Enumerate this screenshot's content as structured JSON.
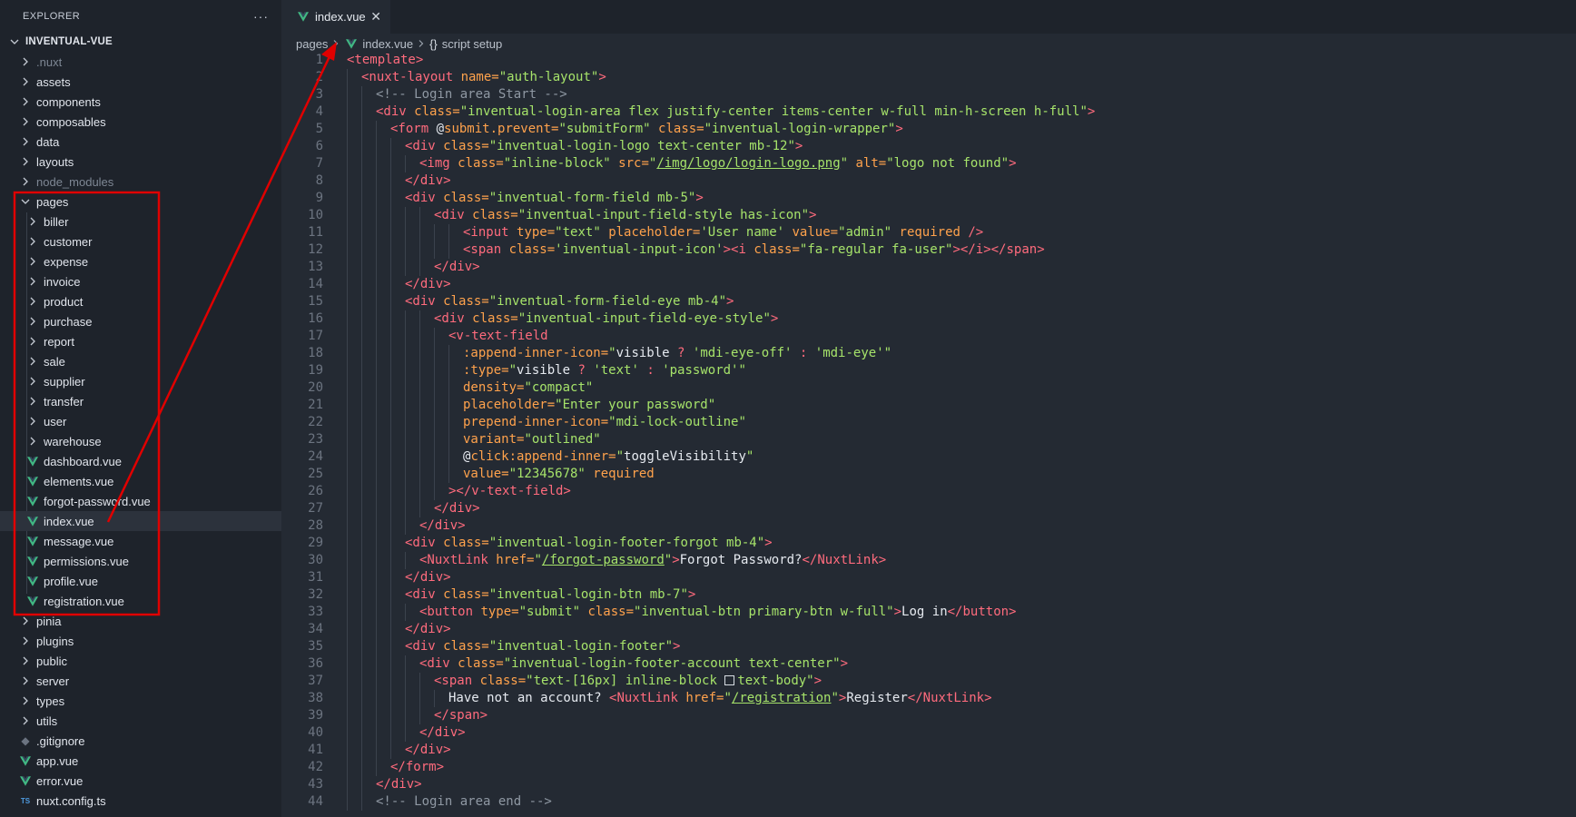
{
  "explorer": {
    "title": "EXPLORER",
    "more": "···",
    "tree": [
      {
        "label": "INVENTUAL-VUE",
        "kind": "root"
      },
      {
        "label": ".nuxt",
        "kind": "folder",
        "dim": true
      },
      {
        "label": "assets",
        "kind": "folder"
      },
      {
        "label": "components",
        "kind": "folder"
      },
      {
        "label": "composables",
        "kind": "folder"
      },
      {
        "label": "data",
        "kind": "folder"
      },
      {
        "label": "layouts",
        "kind": "folder"
      },
      {
        "label": "node_modules",
        "kind": "folder",
        "dim": true
      },
      {
        "label": "pages",
        "kind": "folder-open"
      },
      {
        "label": "biller",
        "kind": "folder",
        "depth": 1
      },
      {
        "label": "customer",
        "kind": "folder",
        "depth": 1
      },
      {
        "label": "expense",
        "kind": "folder",
        "depth": 1
      },
      {
        "label": "invoice",
        "kind": "folder",
        "depth": 1
      },
      {
        "label": "product",
        "kind": "folder",
        "depth": 1
      },
      {
        "label": "purchase",
        "kind": "folder",
        "depth": 1
      },
      {
        "label": "report",
        "kind": "folder",
        "depth": 1
      },
      {
        "label": "sale",
        "kind": "folder",
        "depth": 1
      },
      {
        "label": "supplier",
        "kind": "folder",
        "depth": 1
      },
      {
        "label": "transfer",
        "kind": "folder",
        "depth": 1
      },
      {
        "label": "user",
        "kind": "folder",
        "depth": 1
      },
      {
        "label": "warehouse",
        "kind": "folder",
        "depth": 1
      },
      {
        "label": "dashboard.vue",
        "kind": "vue",
        "depth": 1
      },
      {
        "label": "elements.vue",
        "kind": "vue",
        "depth": 1
      },
      {
        "label": "forgot-password.vue",
        "kind": "vue",
        "depth": 1
      },
      {
        "label": "index.vue",
        "kind": "vue",
        "depth": 1,
        "active": true
      },
      {
        "label": "message.vue",
        "kind": "vue",
        "depth": 1
      },
      {
        "label": "permissions.vue",
        "kind": "vue",
        "depth": 1
      },
      {
        "label": "profile.vue",
        "kind": "vue",
        "depth": 1
      },
      {
        "label": "registration.vue",
        "kind": "vue",
        "depth": 1
      },
      {
        "label": "pinia",
        "kind": "folder"
      },
      {
        "label": "plugins",
        "kind": "folder"
      },
      {
        "label": "public",
        "kind": "folder"
      },
      {
        "label": "server",
        "kind": "folder"
      },
      {
        "label": "types",
        "kind": "folder"
      },
      {
        "label": "utils",
        "kind": "folder"
      },
      {
        "label": ".gitignore",
        "kind": "git"
      },
      {
        "label": "app.vue",
        "kind": "vue"
      },
      {
        "label": "error.vue",
        "kind": "vue"
      },
      {
        "label": "nuxt.config.ts",
        "kind": "ts"
      }
    ]
  },
  "tab": {
    "label": "index.vue",
    "close": "✕"
  },
  "breadcrumb": {
    "folder": "pages",
    "file": "index.vue",
    "symbol_icon": "{}",
    "symbol": "script setup"
  },
  "editor": {
    "lines": [
      {
        "n": "1",
        "indent": 0,
        "segs": [
          [
            "tag",
            "<template>"
          ]
        ]
      },
      {
        "n": "2",
        "indent": 1,
        "segs": [
          [
            "tag",
            "<nuxt-layout "
          ],
          [
            "attr",
            "name="
          ],
          [
            "str",
            "\"auth-layout\""
          ],
          [
            "tag",
            ">"
          ]
        ]
      },
      {
        "n": "3",
        "indent": 2,
        "segs": [
          [
            "cmt",
            "<!-- Login area Start -->"
          ]
        ]
      },
      {
        "n": "4",
        "indent": 2,
        "segs": [
          [
            "tag",
            "<div "
          ],
          [
            "attr",
            "class="
          ],
          [
            "str",
            "\"inventual-login-area flex justify-center items-center w-full min-h-screen h-full\""
          ],
          [
            "tag",
            ">"
          ]
        ]
      },
      {
        "n": "5",
        "indent": 3,
        "segs": [
          [
            "tag",
            "<form "
          ],
          [
            "txt",
            "@"
          ],
          [
            "attr",
            "submit.prevent="
          ],
          [
            "str",
            "\"submitForm\" "
          ],
          [
            "attr",
            "class="
          ],
          [
            "str",
            "\"inventual-login-wrapper\""
          ],
          [
            "tag",
            ">"
          ]
        ]
      },
      {
        "n": "6",
        "indent": 4,
        "segs": [
          [
            "tag",
            "<div "
          ],
          [
            "attr",
            "class="
          ],
          [
            "str",
            "\"inventual-login-logo text-center mb-12\""
          ],
          [
            "tag",
            ">"
          ]
        ]
      },
      {
        "n": "7",
        "indent": 5,
        "segs": [
          [
            "tag",
            "<img "
          ],
          [
            "attr",
            "class="
          ],
          [
            "str",
            "\"inline-block\" "
          ],
          [
            "attr",
            "src="
          ],
          [
            "str",
            "\""
          ],
          [
            "strlink",
            "/img/logo/login-logo.png"
          ],
          [
            "str",
            "\" "
          ],
          [
            "attr",
            "alt="
          ],
          [
            "str",
            "\"logo not found\""
          ],
          [
            "tag",
            ">"
          ]
        ]
      },
      {
        "n": "8",
        "indent": 4,
        "segs": [
          [
            "tag",
            "</div>"
          ]
        ]
      },
      {
        "n": "9",
        "indent": 4,
        "segs": [
          [
            "tag",
            "<div "
          ],
          [
            "attr",
            "class="
          ],
          [
            "str",
            "\"inventual-form-field mb-5\""
          ],
          [
            "tag",
            ">"
          ]
        ]
      },
      {
        "n": "10",
        "indent": 6,
        "segs": [
          [
            "tag",
            "<div "
          ],
          [
            "attr",
            "class="
          ],
          [
            "str",
            "\"inventual-input-field-style has-icon\""
          ],
          [
            "tag",
            ">"
          ]
        ]
      },
      {
        "n": "11",
        "indent": 8,
        "segs": [
          [
            "tag",
            "<input "
          ],
          [
            "attr",
            "type="
          ],
          [
            "str",
            "\"text\" "
          ],
          [
            "attr",
            "placeholder="
          ],
          [
            "str",
            "'User name' "
          ],
          [
            "attr",
            "value="
          ],
          [
            "str",
            "\"admin\" "
          ],
          [
            "attr",
            "required "
          ],
          [
            "tag",
            "/>"
          ]
        ]
      },
      {
        "n": "12",
        "indent": 8,
        "segs": [
          [
            "tag",
            "<span "
          ],
          [
            "attr",
            "class="
          ],
          [
            "str",
            "'inventual-input-icon'"
          ],
          [
            "tag",
            ">"
          ],
          [
            "tag",
            "<i "
          ],
          [
            "attr",
            "class="
          ],
          [
            "str",
            "\"fa-regular fa-user\""
          ],
          [
            "tag",
            "></i></span>"
          ]
        ]
      },
      {
        "n": "13",
        "indent": 6,
        "segs": [
          [
            "tag",
            "</div>"
          ]
        ]
      },
      {
        "n": "14",
        "indent": 4,
        "segs": [
          [
            "tag",
            "</div>"
          ]
        ]
      },
      {
        "n": "15",
        "indent": 4,
        "segs": [
          [
            "tag",
            "<div "
          ],
          [
            "attr",
            "class="
          ],
          [
            "str",
            "\"inventual-form-field-eye mb-4\""
          ],
          [
            "tag",
            ">"
          ]
        ]
      },
      {
        "n": "16",
        "indent": 6,
        "segs": [
          [
            "tag",
            "<div "
          ],
          [
            "attr",
            "class="
          ],
          [
            "str",
            "\"inventual-input-field-eye-style\""
          ],
          [
            "tag",
            ">"
          ]
        ]
      },
      {
        "n": "17",
        "indent": 7,
        "segs": [
          [
            "tag",
            "<v-text-field"
          ]
        ]
      },
      {
        "n": "18",
        "indent": 8,
        "segs": [
          [
            "attr",
            ":append-inner-icon="
          ],
          [
            "str",
            "\""
          ],
          [
            "txt",
            "visible "
          ],
          [
            "tag",
            "? "
          ],
          [
            "str",
            "'mdi-eye-off' "
          ],
          [
            "tag",
            ": "
          ],
          [
            "str",
            "'mdi-eye'\""
          ]
        ]
      },
      {
        "n": "19",
        "indent": 8,
        "segs": [
          [
            "attr",
            ":type="
          ],
          [
            "str",
            "\""
          ],
          [
            "txt",
            "visible "
          ],
          [
            "tag",
            "? "
          ],
          [
            "str",
            "'text' "
          ],
          [
            "tag",
            ": "
          ],
          [
            "str",
            "'password'\""
          ]
        ]
      },
      {
        "n": "20",
        "indent": 8,
        "segs": [
          [
            "attr",
            "density="
          ],
          [
            "str",
            "\"compact\""
          ]
        ]
      },
      {
        "n": "21",
        "indent": 8,
        "segs": [
          [
            "attr",
            "placeholder="
          ],
          [
            "str",
            "\"Enter your password\""
          ]
        ]
      },
      {
        "n": "22",
        "indent": 8,
        "segs": [
          [
            "attr",
            "prepend-inner-icon="
          ],
          [
            "str",
            "\"mdi-lock-outline\""
          ]
        ]
      },
      {
        "n": "23",
        "indent": 8,
        "segs": [
          [
            "attr",
            "variant="
          ],
          [
            "str",
            "\"outlined\""
          ]
        ]
      },
      {
        "n": "24",
        "indent": 8,
        "segs": [
          [
            "txt",
            "@"
          ],
          [
            "attr",
            "click:append-inner="
          ],
          [
            "str",
            "\""
          ],
          [
            "txt",
            "toggleVisibility"
          ],
          [
            "str",
            "\""
          ]
        ]
      },
      {
        "n": "25",
        "indent": 8,
        "segs": [
          [
            "attr",
            "value="
          ],
          [
            "str",
            "\"12345678\" "
          ],
          [
            "attr",
            "required"
          ]
        ]
      },
      {
        "n": "26",
        "indent": 7,
        "segs": [
          [
            "tag",
            "></v-text-field>"
          ]
        ]
      },
      {
        "n": "27",
        "indent": 6,
        "segs": [
          [
            "tag",
            "</div>"
          ]
        ]
      },
      {
        "n": "28",
        "indent": 5,
        "segs": [
          [
            "tag",
            "</div>"
          ]
        ]
      },
      {
        "n": "29",
        "indent": 4,
        "segs": [
          [
            "tag",
            "<div "
          ],
          [
            "attr",
            "class="
          ],
          [
            "str",
            "\"inventual-login-footer-forgot mb-4\""
          ],
          [
            "tag",
            ">"
          ]
        ]
      },
      {
        "n": "30",
        "indent": 5,
        "segs": [
          [
            "tag",
            "<NuxtLink "
          ],
          [
            "attr",
            "href="
          ],
          [
            "str",
            "\""
          ],
          [
            "strlink",
            "/forgot-password"
          ],
          [
            "str",
            "\""
          ],
          [
            "tag",
            ">"
          ],
          [
            "txt",
            "Forgot Password?"
          ],
          [
            "tag",
            "</NuxtLink>"
          ]
        ]
      },
      {
        "n": "31",
        "indent": 4,
        "segs": [
          [
            "tag",
            "</div>"
          ]
        ]
      },
      {
        "n": "32",
        "indent": 4,
        "segs": [
          [
            "tag",
            "<div "
          ],
          [
            "attr",
            "class="
          ],
          [
            "str",
            "\"inventual-login-btn mb-7\""
          ],
          [
            "tag",
            ">"
          ]
        ]
      },
      {
        "n": "33",
        "indent": 5,
        "segs": [
          [
            "tag",
            "<button "
          ],
          [
            "attr",
            "type="
          ],
          [
            "str",
            "\"submit\" "
          ],
          [
            "attr",
            "class="
          ],
          [
            "str",
            "\"inventual-btn primary-btn w-full\""
          ],
          [
            "tag",
            ">"
          ],
          [
            "txt",
            "Log in"
          ],
          [
            "tag",
            "</button>"
          ]
        ]
      },
      {
        "n": "34",
        "indent": 4,
        "segs": [
          [
            "tag",
            "</div>"
          ]
        ]
      },
      {
        "n": "35",
        "indent": 4,
        "segs": [
          [
            "tag",
            "<div "
          ],
          [
            "attr",
            "class="
          ],
          [
            "str",
            "\"inventual-login-footer\""
          ],
          [
            "tag",
            ">"
          ]
        ]
      },
      {
        "n": "36",
        "indent": 5,
        "segs": [
          [
            "tag",
            "<div "
          ],
          [
            "attr",
            "class="
          ],
          [
            "str",
            "\"inventual-login-footer-account text-center\""
          ],
          [
            "tag",
            ">"
          ]
        ]
      },
      {
        "n": "37",
        "indent": 6,
        "segs": [
          [
            "tag",
            "<span "
          ],
          [
            "attr",
            "class="
          ],
          [
            "str",
            "\"text-[16px] inline-block "
          ],
          [
            "swatch",
            ""
          ],
          [
            "str",
            "text-body\""
          ],
          [
            "tag",
            ">"
          ]
        ]
      },
      {
        "n": "38",
        "indent": 7,
        "segs": [
          [
            "txt",
            "Have not an account? "
          ],
          [
            "tag",
            "<NuxtLink "
          ],
          [
            "attr",
            "href="
          ],
          [
            "str",
            "\""
          ],
          [
            "strlink",
            "/registration"
          ],
          [
            "str",
            "\""
          ],
          [
            "tag",
            ">"
          ],
          [
            "txt",
            "Register"
          ],
          [
            "tag",
            "</NuxtLink>"
          ]
        ]
      },
      {
        "n": "39",
        "indent": 6,
        "segs": [
          [
            "tag",
            "</span>"
          ]
        ]
      },
      {
        "n": "40",
        "indent": 5,
        "segs": [
          [
            "tag",
            "</div>"
          ]
        ]
      },
      {
        "n": "41",
        "indent": 4,
        "segs": [
          [
            "tag",
            "</div>"
          ]
        ]
      },
      {
        "n": "42",
        "indent": 3,
        "segs": [
          [
            "tag",
            "</form>"
          ]
        ]
      },
      {
        "n": "43",
        "indent": 2,
        "segs": [
          [
            "tag",
            "</div>"
          ]
        ]
      },
      {
        "n": "44",
        "indent": 2,
        "segs": [
          [
            "cmt",
            "<!-- Login area end -->"
          ]
        ]
      }
    ]
  },
  "colors": {
    "sidebar_bg": "#1e232b",
    "editor_bg": "#242a33",
    "vue_green": "#41b883",
    "annotation_red": "#e00000"
  }
}
